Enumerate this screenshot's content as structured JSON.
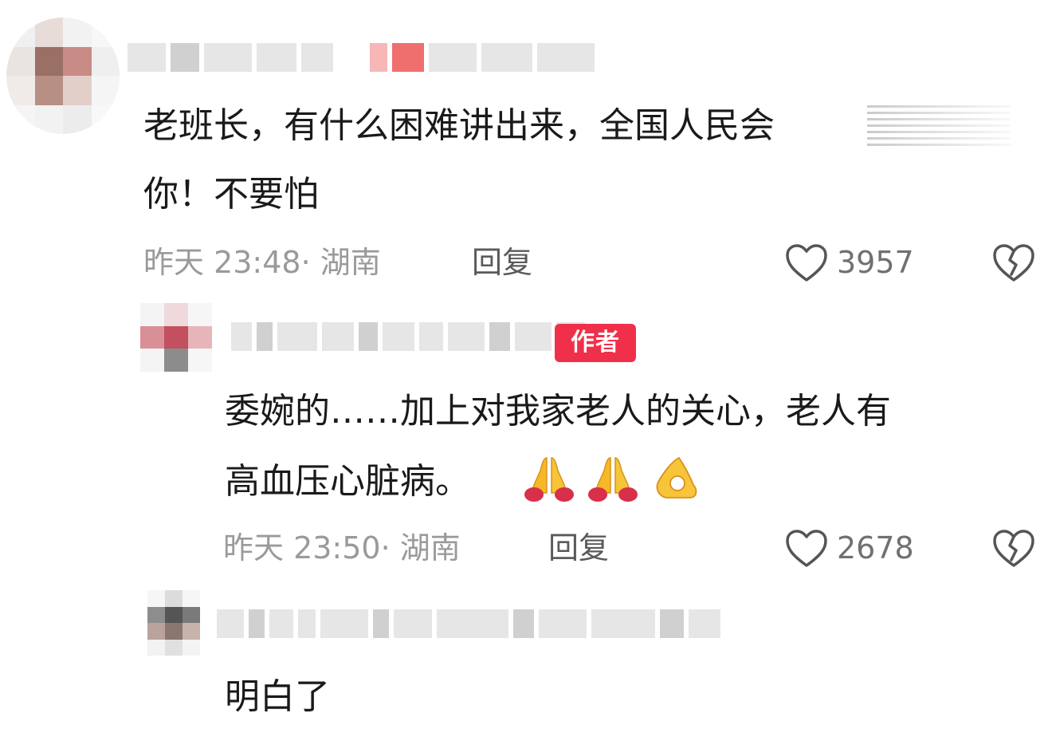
{
  "comments": [
    {
      "text_lines": [
        "老班长，有什么困难讲出来，全国人民会",
        "你！不要怕"
      ],
      "time": "昨天 23:48",
      "location": "湖南",
      "reply_label": "回复",
      "likes": "3957"
    },
    {
      "badge": "作者",
      "text_lines": [
        "委婉的……加上对我家老人的关心，老人有",
        "高血压心脏病。"
      ],
      "emojis": [
        "folded-hands",
        "folded-hands",
        "ok-hand"
      ],
      "time": "昨天 23:50",
      "location": "湖南",
      "reply_label": "回复",
      "likes": "2678"
    },
    {
      "text_lines": [
        "明白了"
      ]
    }
  ],
  "colors": {
    "badge": "#f0304a",
    "meta_text": "#9a9a9a",
    "body_text": "#1a1a1a"
  }
}
